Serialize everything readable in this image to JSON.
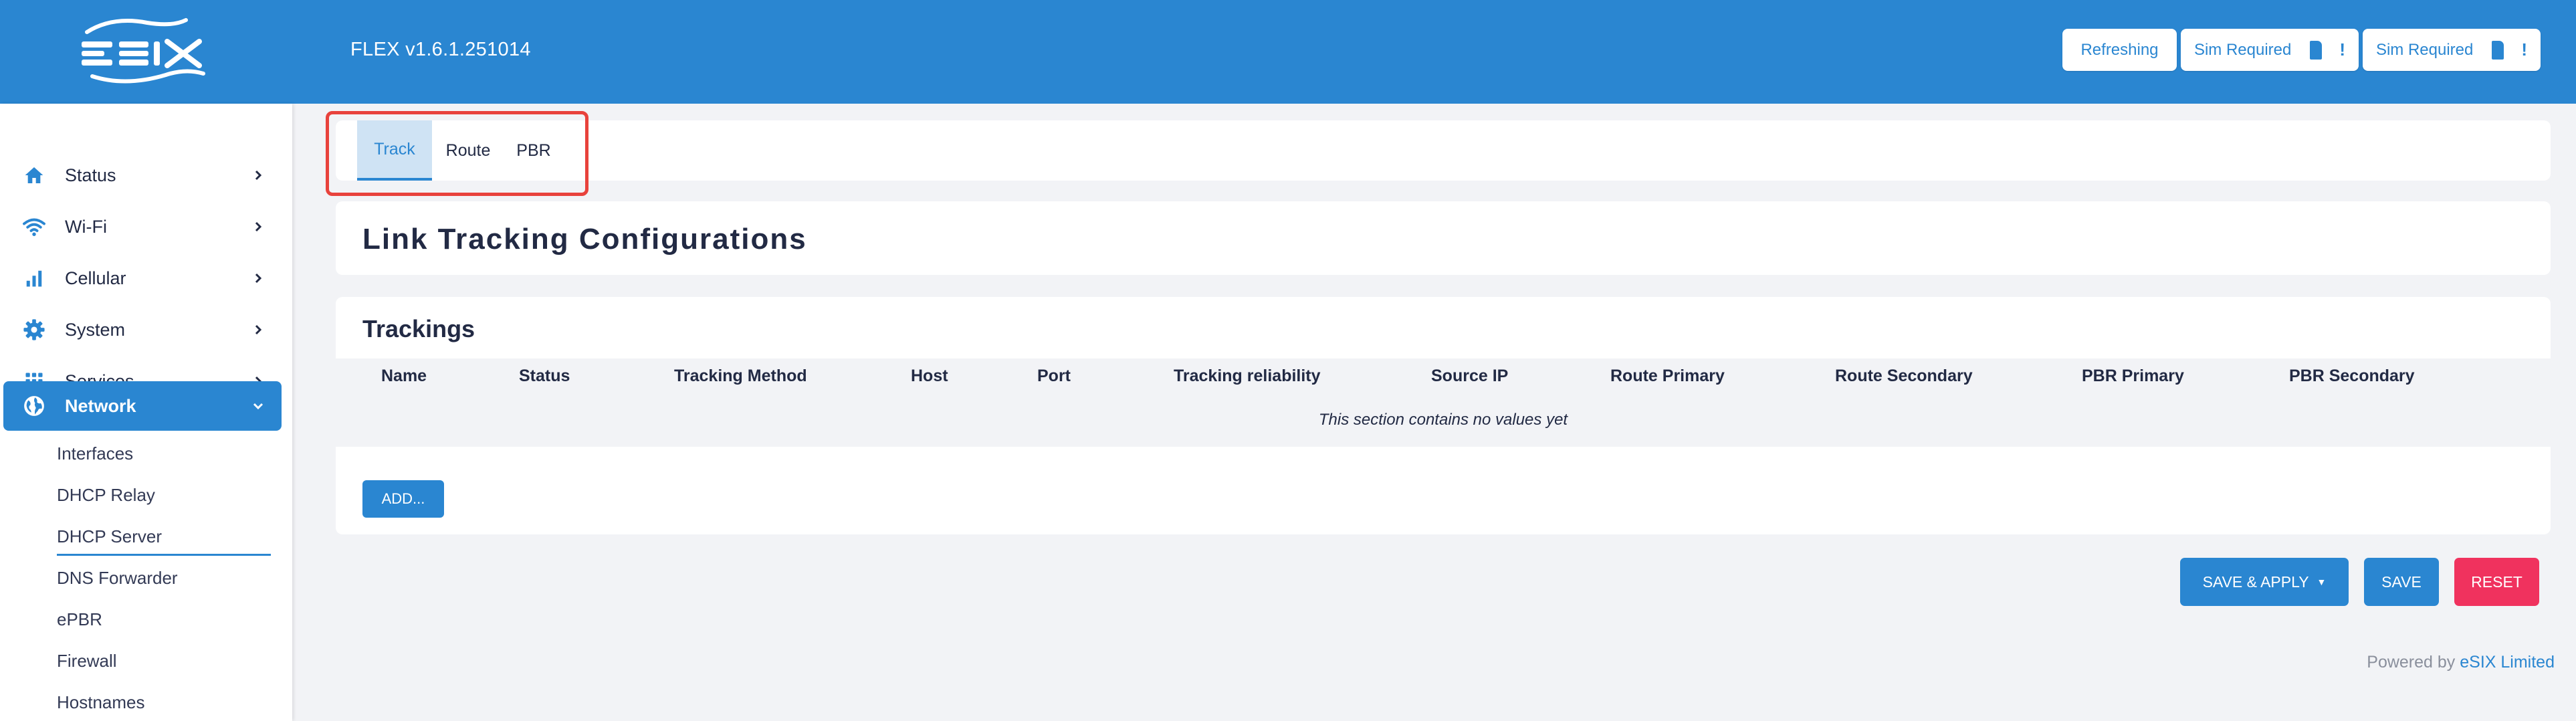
{
  "colors": {
    "brand": "#2a86d1",
    "reset": "#f0325e",
    "highlight": "#e8423c"
  },
  "header": {
    "logo_text": "eSIX",
    "version": "FLEX v1.6.1.251014",
    "buttons": [
      {
        "label": "Refreshing"
      },
      {
        "label": "Sim Required",
        "badge": "!"
      },
      {
        "label": "Sim Required",
        "badge": "!"
      }
    ]
  },
  "sidebar": {
    "items": [
      {
        "label": "Status",
        "icon": "home-icon"
      },
      {
        "label": "Wi-Fi",
        "icon": "wifi-icon"
      },
      {
        "label": "Cellular",
        "icon": "signal-bars-icon"
      },
      {
        "label": "System",
        "icon": "gear-icon"
      },
      {
        "label": "Services",
        "icon": "grid-icon"
      },
      {
        "label": "Network",
        "icon": "globe-icon",
        "active": true
      }
    ],
    "subitems": [
      {
        "label": "Interfaces"
      },
      {
        "label": "DHCP Relay"
      },
      {
        "label": "DHCP Server",
        "underlined": true
      },
      {
        "label": "DNS Forwarder"
      },
      {
        "label": "ePBR"
      },
      {
        "label": "Firewall"
      },
      {
        "label": "Hostnames"
      }
    ]
  },
  "tabs": [
    {
      "label": "Track",
      "active": true
    },
    {
      "label": "Route"
    },
    {
      "label": "PBR"
    }
  ],
  "page": {
    "title": "Link Tracking Configurations"
  },
  "trackings": {
    "title": "Trackings",
    "columns": [
      "Name",
      "Status",
      "Tracking Method",
      "Host",
      "Port",
      "Tracking reliability",
      "Source IP",
      "Route Primary",
      "Route Secondary",
      "PBR Primary",
      "PBR Secondary"
    ],
    "empty_text": "This section contains no values yet",
    "add_label": "ADD..."
  },
  "actions": {
    "save_apply": "SAVE & APPLY",
    "save": "SAVE",
    "reset": "RESET"
  },
  "footer": {
    "prefix": "Powered by",
    "link": "eSIX Limited"
  }
}
